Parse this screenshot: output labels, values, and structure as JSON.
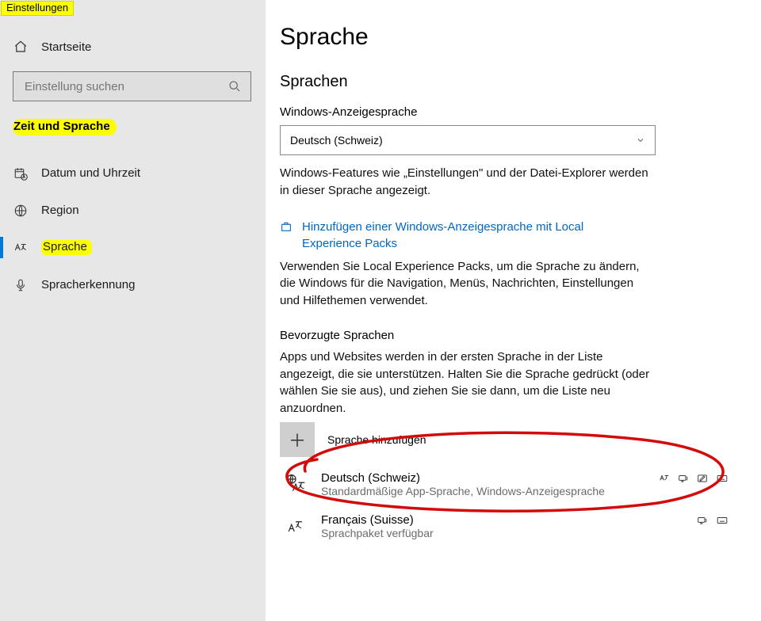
{
  "app_title": "Einstellungen",
  "sidebar": {
    "home": "Startseite",
    "search_placeholder": "Einstellung suchen",
    "section": "Zeit und Sprache",
    "items": [
      {
        "label": "Datum und Uhrzeit"
      },
      {
        "label": "Region"
      },
      {
        "label": "Sprache"
      },
      {
        "label": "Spracherkennung"
      }
    ]
  },
  "main": {
    "title": "Sprache",
    "languages_heading": "Sprachen",
    "display_lang_label": "Windows-Anzeigesprache",
    "display_lang_value": "Deutsch (Schweiz)",
    "display_lang_help": "Windows-Features wie „Einstellungen\" und der Datei-Explorer werden in dieser Sprache angezeigt.",
    "store_link": "Hinzufügen einer Windows-Anzeigesprache mit Local Experience Packs",
    "store_help": "Verwenden Sie Local Experience Packs, um die Sprache zu ändern, die Windows für die Navigation, Menüs, Nachrichten, Einstellungen und Hilfethemen verwendet.",
    "preferred_heading": "Bevorzugte Sprachen",
    "preferred_help": "Apps und Websites werden in der ersten Sprache in der Liste angezeigt, die sie unterstützen. Halten Sie die Sprache gedrückt (oder wählen Sie sie aus), und ziehen Sie sie dann, um die Liste neu anzuordnen.",
    "add_language": "Sprache hinzufügen",
    "languages": [
      {
        "name": "Deutsch (Schweiz)",
        "sub": "Standardmäßige App-Sprache, Windows-Anzeigesprache",
        "features": [
          "display",
          "tts",
          "handwriting",
          "keyboard"
        ]
      },
      {
        "name": "Français (Suisse)",
        "sub": "Sprachpaket verfügbar",
        "features": [
          "tts",
          "keyboard"
        ]
      }
    ]
  },
  "annotations": [
    {
      "type": "oval",
      "target": "add-language"
    }
  ]
}
